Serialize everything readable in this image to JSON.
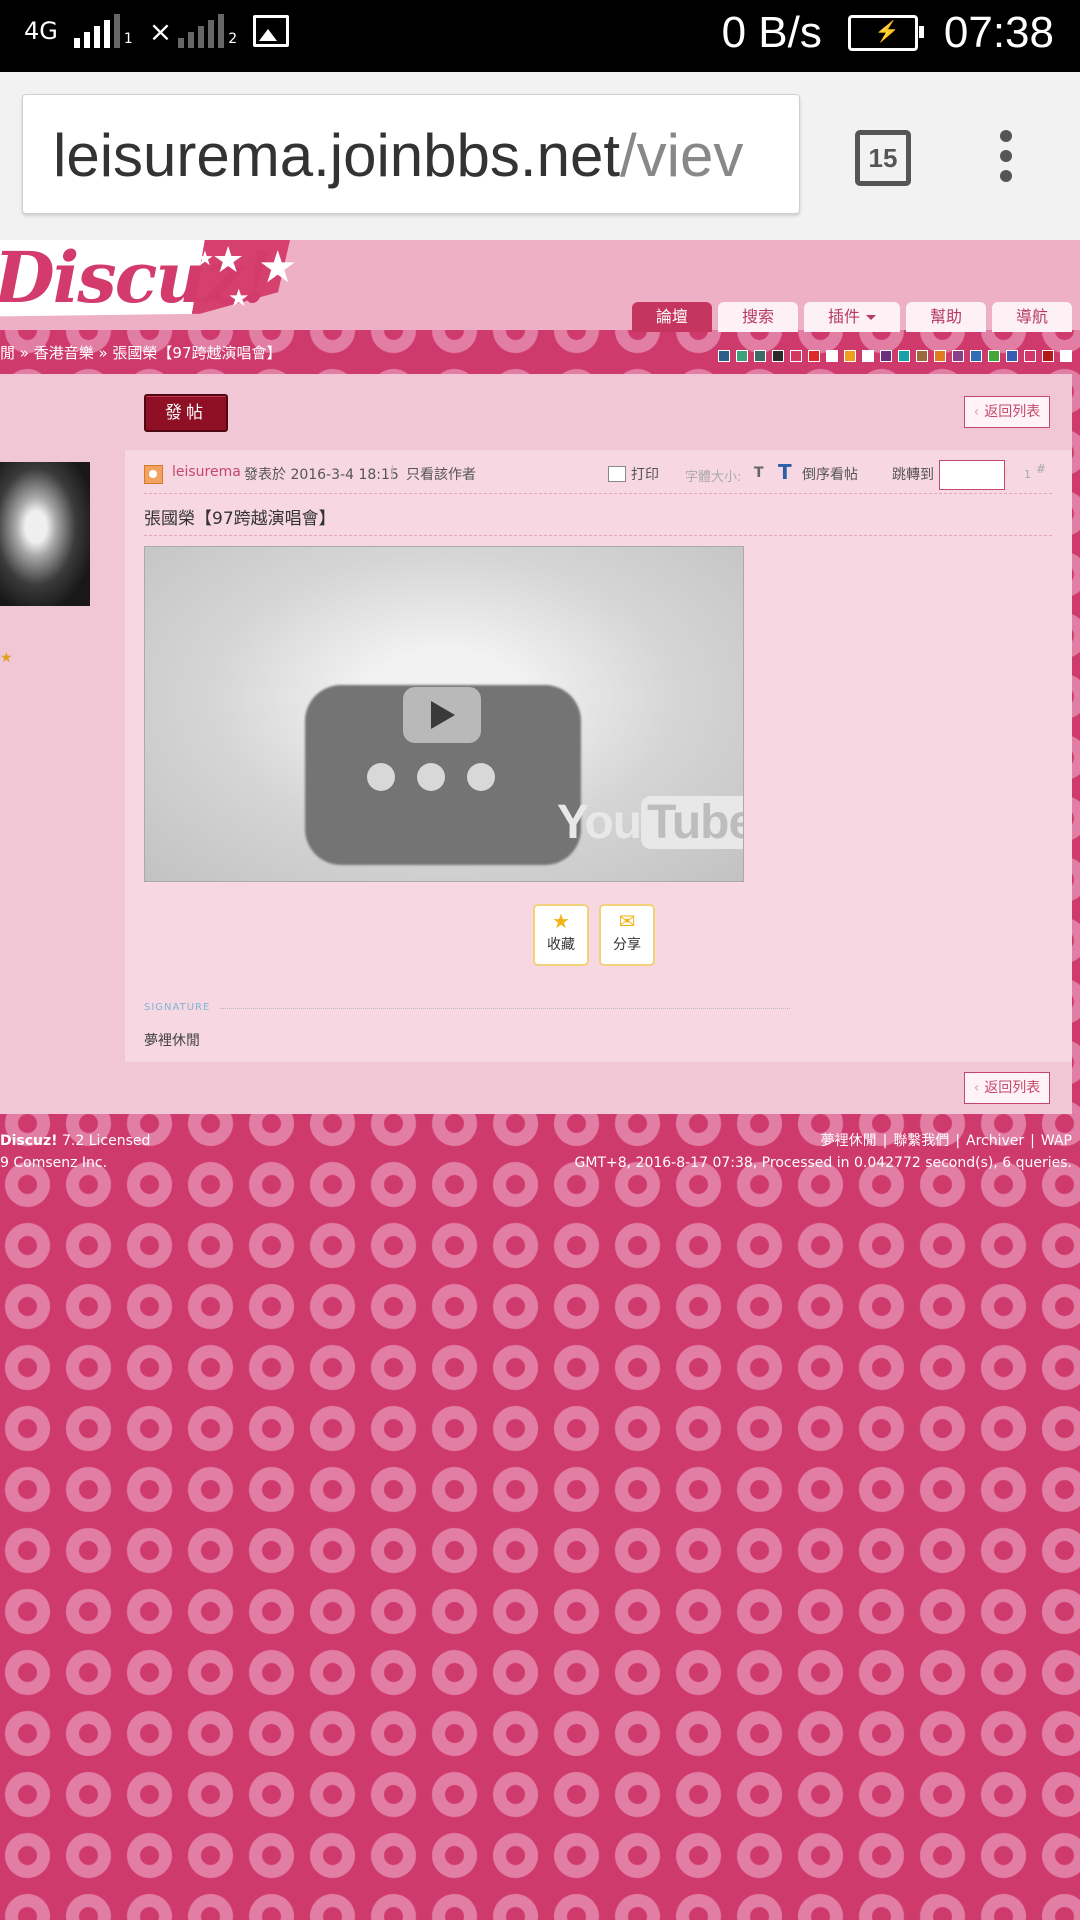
{
  "status_bar": {
    "network": "4G",
    "sim1_label": "1",
    "sim2_label": "2",
    "speed": "0 B/s",
    "time": "07:38"
  },
  "browser": {
    "url_host": "leisurema.joinbbs.net",
    "url_rest": "/viev",
    "tab_count": "15"
  },
  "header": {
    "logo_text": "Discuz!",
    "nav": [
      {
        "label": "論壇"
      },
      {
        "label": "搜索"
      },
      {
        "label": "插件"
      },
      {
        "label": "幫助"
      },
      {
        "label": "導航"
      }
    ],
    "breadcrumb": "閒 » 香港音樂 » 張國榮【97跨越演唱會】",
    "swatches": [
      "#2f5d8a",
      "#3fa07b",
      "#3e6b67",
      "#2b2b2b",
      "#d2385f",
      "#e02a2a",
      "#ffffff",
      "#f29d1f",
      "#ffffff",
      "#6a2e7d",
      "#17a2a7",
      "#9a6a3e",
      "#e07b1f",
      "#8a3f8a",
      "#2f6db5",
      "#42a63a",
      "#3b5bb5",
      "#d3386a",
      "#b31a1a",
      "#ffffff"
    ]
  },
  "post": {
    "post_button": "發帖",
    "back_to_list": "返回列表",
    "author": "leisurema",
    "date": "發表於 2016-3-4 18:15",
    "only_author": "只看該作者",
    "print": "打印",
    "font_size_label": "字體大小:",
    "font_size_t": "T",
    "reverse_t": "T",
    "reverse_order": "倒序看帖",
    "goto_label": "跳轉到",
    "post_number": "1",
    "hash": "#",
    "title": "張國榮【97跨越演唱會】",
    "video_logo_you": "You",
    "video_logo_tube": "Tube",
    "favorite": "收藏",
    "share": "分享",
    "signature_label": "SIGNATURE",
    "signature": "夢裡休閒",
    "back_to_list_bottom": "返回列表"
  },
  "footer": {
    "left_line1_brand": "Discuz!",
    "left_line1_rest": " 7.2 Licensed",
    "left_line2": "9 Comsenz Inc.",
    "links": [
      "夢裡休閒",
      "聯繫我們",
      "Archiver",
      "WAP"
    ],
    "stats": "GMT+8, 2016-8-17 07:38, Processed in 0.042772 second(s), 6 queries."
  }
}
